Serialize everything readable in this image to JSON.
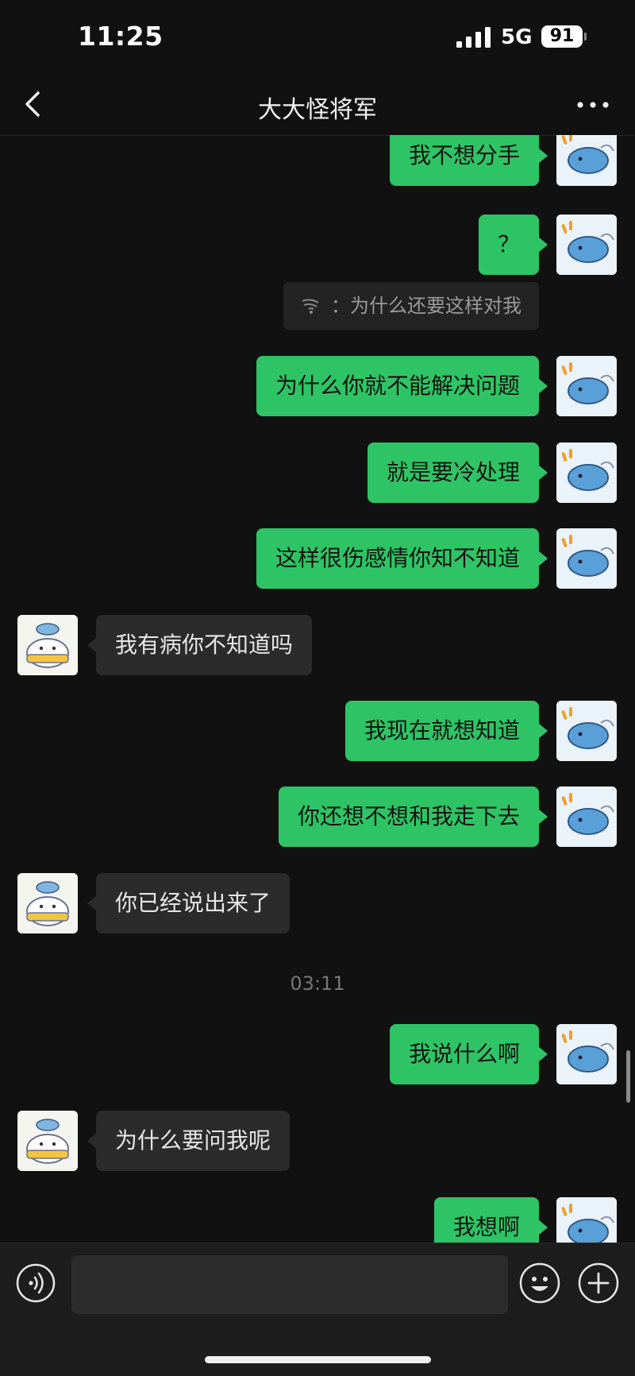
{
  "status_bar": {
    "time": "11:25",
    "network": "5G",
    "battery": "91"
  },
  "header": {
    "title": "大大怪将军"
  },
  "messages": [
    {
      "side": "me",
      "text": "我不想分手"
    },
    {
      "side": "me",
      "text": "？"
    },
    {
      "side": "quote",
      "text": "：为什么还要这样对我"
    },
    {
      "side": "me",
      "text": "为什么你就不能解决问题"
    },
    {
      "side": "me",
      "text": "就是要冷处理"
    },
    {
      "side": "me",
      "text": "这样很伤感情你知不知道"
    },
    {
      "side": "them",
      "text": "我有病你不知道吗"
    },
    {
      "side": "me",
      "text": "我现在就想知道"
    },
    {
      "side": "me",
      "text": "你还想不想和我走下去"
    },
    {
      "side": "them",
      "text": "你已经说出来了"
    },
    {
      "side": "time",
      "text": "03:11"
    },
    {
      "side": "me",
      "text": "我说什么啊"
    },
    {
      "side": "them",
      "text": "为什么要问我呢"
    },
    {
      "side": "me",
      "text": "我想啊"
    }
  ],
  "input_bar": {
    "placeholder": ""
  },
  "colors": {
    "outgoing_bubble": "#2ec465",
    "incoming_bubble": "#2b2b2b",
    "background": "#111111"
  }
}
